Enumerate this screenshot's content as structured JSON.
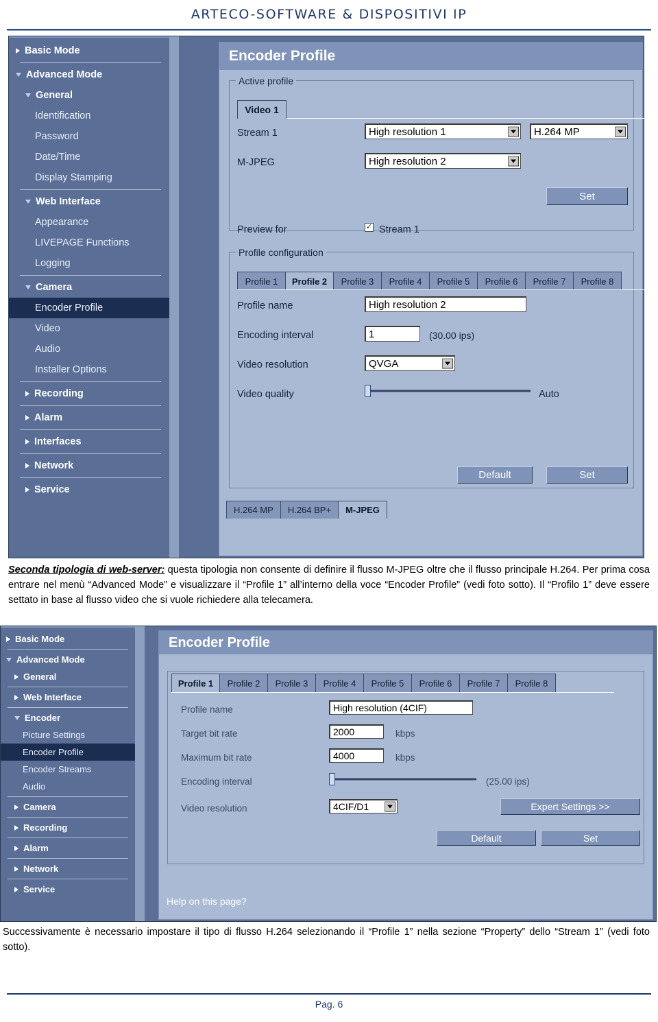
{
  "document": {
    "header_title": "ARTECO-SOFTWARE & DISPOSITIVI IP",
    "page_label": "Pag.   6"
  },
  "colors": {
    "header_text": "#1F3864",
    "panel_bg": "#aab9d4",
    "panel_title_bg": "#7f93b8",
    "sidebar_bg": "#5a6e96",
    "sidebar_selected": "#1b2e52",
    "button_bg": "#7f93b8"
  },
  "screenshot1": {
    "sidebar": [
      {
        "label": "Basic Mode",
        "level": 0,
        "icon": "chevron-right-icon",
        "selected": false,
        "sep_after": true
      },
      {
        "label": "Advanced Mode",
        "level": 0,
        "icon": "chevron-down-icon",
        "selected": false,
        "sep_after": false
      },
      {
        "label": "General",
        "level": 1,
        "icon": "chevron-down-icon",
        "selected": false,
        "sep_after": false
      },
      {
        "label": "Identification",
        "level": 2,
        "icon": "none",
        "selected": false,
        "sep_after": false
      },
      {
        "label": "Password",
        "level": 2,
        "icon": "none",
        "selected": false,
        "sep_after": false
      },
      {
        "label": "Date/Time",
        "level": 2,
        "icon": "none",
        "selected": false,
        "sep_after": false
      },
      {
        "label": "Display Stamping",
        "level": 2,
        "icon": "none",
        "selected": false,
        "sep_after": true
      },
      {
        "label": "Web Interface",
        "level": 1,
        "icon": "chevron-down-icon",
        "selected": false,
        "sep_after": false
      },
      {
        "label": "Appearance",
        "level": 2,
        "icon": "none",
        "selected": false,
        "sep_after": false
      },
      {
        "label": "LIVEPAGE Functions",
        "level": 2,
        "icon": "none",
        "selected": false,
        "sep_after": false
      },
      {
        "label": "Logging",
        "level": 2,
        "icon": "none",
        "selected": false,
        "sep_after": true
      },
      {
        "label": "Camera",
        "level": 1,
        "icon": "chevron-down-icon",
        "selected": false,
        "sep_after": false
      },
      {
        "label": "Encoder Profile",
        "level": 2,
        "icon": "none",
        "selected": true,
        "sep_after": false
      },
      {
        "label": "Video",
        "level": 2,
        "icon": "none",
        "selected": false,
        "sep_after": false
      },
      {
        "label": "Audio",
        "level": 2,
        "icon": "none",
        "selected": false,
        "sep_after": false
      },
      {
        "label": "Installer Options",
        "level": 2,
        "icon": "none",
        "selected": false,
        "sep_after": true
      },
      {
        "label": "Recording",
        "level": 1,
        "icon": "chevron-right-icon",
        "selected": false,
        "sep_after": true
      },
      {
        "label": "Alarm",
        "level": 1,
        "icon": "chevron-right-icon",
        "selected": false,
        "sep_after": true
      },
      {
        "label": "Interfaces",
        "level": 1,
        "icon": "chevron-right-icon",
        "selected": false,
        "sep_after": true
      },
      {
        "label": "Network",
        "level": 1,
        "icon": "chevron-right-icon",
        "selected": false,
        "sep_after": true
      },
      {
        "label": "Service",
        "level": 1,
        "icon": "chevron-right-icon",
        "selected": false,
        "sep_after": false
      }
    ],
    "panel_title": "Encoder Profile",
    "active_profile": {
      "legend": "Active profile",
      "tab": "Video 1",
      "stream1_label": "Stream 1",
      "stream1_profile": "High resolution 1",
      "stream1_codec": "H.264 MP",
      "mjpeg_label": "M-JPEG",
      "mjpeg_profile": "High resolution 2",
      "set_button": "Set",
      "preview_label": "Preview for",
      "preview_checkbox_label": "Stream 1",
      "preview_checked": true
    },
    "profile_config": {
      "legend": "Profile configuration",
      "tabs": [
        "Profile 1",
        "Profile 2",
        "Profile 3",
        "Profile 4",
        "Profile 5",
        "Profile 6",
        "Profile 7",
        "Profile 8"
      ],
      "active_tab_index": 1,
      "profile_name_label": "Profile name",
      "profile_name_value": "High resolution 2",
      "encoding_interval_label": "Encoding interval",
      "encoding_interval_value": "1",
      "encoding_interval_hint": "(30.00 ips)",
      "video_resolution_label": "Video resolution",
      "video_resolution_value": "QVGA",
      "video_quality_label": "Video quality",
      "video_quality_value": "Auto",
      "default_button": "Default",
      "set_button": "Set"
    },
    "codec_tabs": [
      "H.264 MP",
      "H.264 BP+",
      "M-JPEG"
    ],
    "codec_active_index": 2
  },
  "paragraph1": {
    "lead": "Seconda tipologia di web-server:",
    "body": " questa tipologia non consente di definire il flusso M-JPEG oltre che il flusso principale H.264. Per prima cosa entrare nel menù “Advanced Mode” e visualizzare il “Profile 1” all’interno della voce “Encoder Profile” (vedi foto sotto). Il “Profilo 1” deve essere settato in base al flusso video che si vuole richiedere alla telecamera."
  },
  "screenshot2": {
    "sidebar": [
      {
        "label": "Basic Mode",
        "level": 0,
        "icon": "chevron-right-icon",
        "selected": false,
        "sep_after": true
      },
      {
        "label": "Advanced Mode",
        "level": 0,
        "icon": "chevron-down-icon",
        "selected": false,
        "sep_after": false
      },
      {
        "label": "General",
        "level": 1,
        "icon": "chevron-right-icon",
        "selected": false,
        "sep_after": true
      },
      {
        "label": "Web Interface",
        "level": 1,
        "icon": "chevron-right-icon",
        "selected": false,
        "sep_after": true
      },
      {
        "label": "Encoder",
        "level": 1,
        "icon": "chevron-down-icon",
        "selected": false,
        "sep_after": false
      },
      {
        "label": "Picture Settings",
        "level": 2,
        "icon": "none",
        "selected": false,
        "sep_after": false
      },
      {
        "label": "Encoder Profile",
        "level": 2,
        "icon": "none",
        "selected": true,
        "sep_after": false
      },
      {
        "label": "Encoder Streams",
        "level": 2,
        "icon": "none",
        "selected": false,
        "sep_after": false
      },
      {
        "label": "Audio",
        "level": 2,
        "icon": "none",
        "selected": false,
        "sep_after": true
      },
      {
        "label": "Camera",
        "level": 1,
        "icon": "chevron-right-icon",
        "selected": false,
        "sep_after": true
      },
      {
        "label": "Recording",
        "level": 1,
        "icon": "chevron-right-icon",
        "selected": false,
        "sep_after": true
      },
      {
        "label": "Alarm",
        "level": 1,
        "icon": "chevron-right-icon",
        "selected": false,
        "sep_after": true
      },
      {
        "label": "Network",
        "level": 1,
        "icon": "chevron-right-icon",
        "selected": false,
        "sep_after": true
      },
      {
        "label": "Service",
        "level": 1,
        "icon": "chevron-right-icon",
        "selected": false,
        "sep_after": false
      }
    ],
    "panel_title": "Encoder Profile",
    "tabs": [
      "Profile 1",
      "Profile 2",
      "Profile 3",
      "Profile 4",
      "Profile 5",
      "Profile 6",
      "Profile 7",
      "Profile 8"
    ],
    "active_tab_index": 0,
    "profile_name_label": "Profile name",
    "profile_name_value": "High resolution (4CIF)",
    "target_bitrate_label": "Target bit rate",
    "target_bitrate_value": "2000",
    "target_bitrate_unit": "kbps",
    "max_bitrate_label": "Maximum bit rate",
    "max_bitrate_value": "4000",
    "max_bitrate_unit": "kbps",
    "encoding_interval_label": "Encoding interval",
    "encoding_interval_hint": "(25.00 ips)",
    "video_resolution_label": "Video resolution",
    "video_resolution_value": "4CIF/D1",
    "expert_settings_button": "Expert Settings >>",
    "default_button": "Default",
    "set_button": "Set",
    "help_link": "Help on this page?"
  },
  "paragraph2": {
    "body": "Successivamente è necessario impostare il tipo di flusso H.264 selezionando il “Profile 1” nella sezione “Property” dello “Stream 1” (vedi foto sotto)."
  }
}
